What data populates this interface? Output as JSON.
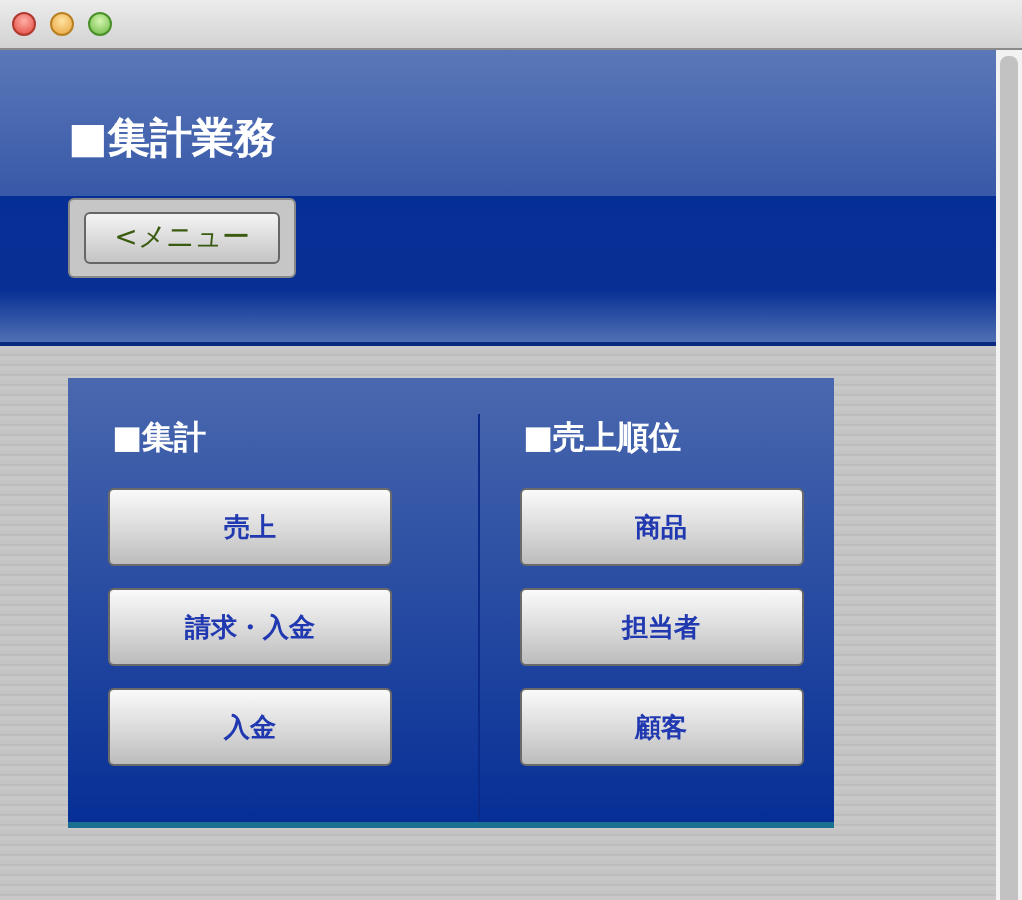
{
  "header": {
    "title": "■集計業務",
    "back_button": "<メニュー"
  },
  "sections": [
    {
      "heading": "■集計",
      "buttons": [
        "売上",
        "請求・入金",
        "入金"
      ]
    },
    {
      "heading": "■売上順位",
      "buttons": [
        "商品",
        "担当者",
        "顧客"
      ]
    }
  ]
}
